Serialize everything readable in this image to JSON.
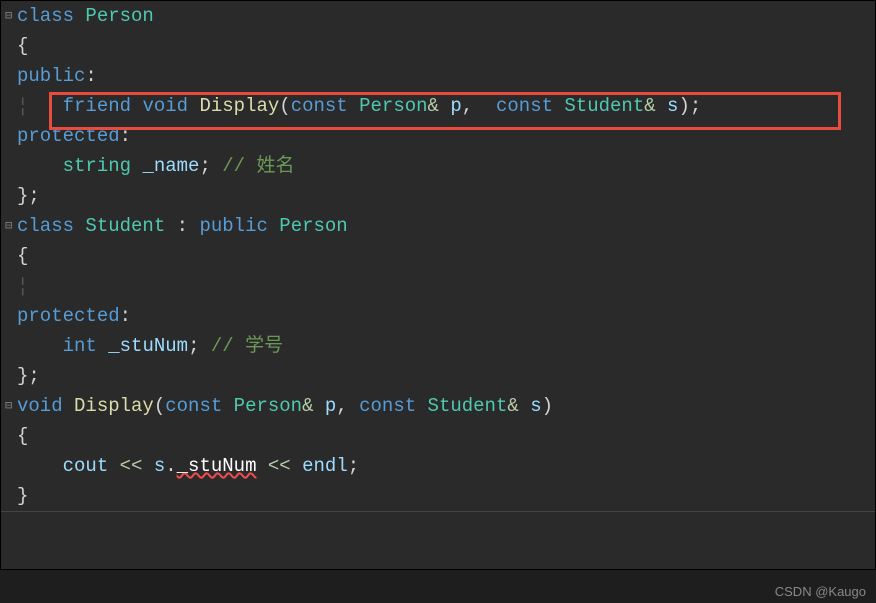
{
  "lines": {
    "l1_class": "class",
    "l1_name": "Person",
    "l2_brace": "{",
    "l3_public": "public",
    "l3_colon": ":",
    "l4_friend": "friend",
    "l4_void": "void",
    "l4_fn": "Display",
    "l4_const1": "const",
    "l4_t1": "Person",
    "l4_amp1": "&",
    "l4_p1": "p",
    "l4_comma": ",",
    "l4_const2": "const",
    "l4_t2": "Student",
    "l4_amp2": "&",
    "l4_p2": "s",
    "l4_paren_close": ");",
    "l5_protected": "protected",
    "l5_colon": ":",
    "l6_type": "string",
    "l6_name": "_name",
    "l6_semi": ";",
    "l6_comment": "// 姓名",
    "l7_close": "};",
    "l8_class": "class",
    "l8_name": "Student",
    "l8_colon": ":",
    "l8_public": "public",
    "l8_base": "Person",
    "l9_brace": "{",
    "l11_protected": "protected",
    "l11_colon": ":",
    "l12_type": "int",
    "l12_name": "_stuNum",
    "l12_semi": ";",
    "l12_comment": "// 学号",
    "l13_close": "};",
    "l14_void": "void",
    "l14_fn": "Display",
    "l14_const1": "const",
    "l14_t1": "Person",
    "l14_amp1": "&",
    "l14_p1": "p",
    "l14_comma": ",",
    "l14_const2": "const",
    "l14_t2": "Student",
    "l14_amp2": "&",
    "l14_p2": "s",
    "l14_paren_close": ")",
    "l15_brace": "{",
    "l16_cout": "cout",
    "l16_op1": "<<",
    "l16_s": "s",
    "l16_dot": ".",
    "l16_member": "_stuNum",
    "l16_op2": "<<",
    "l16_endl": "endl",
    "l16_semi": ";",
    "l17_brace": "}"
  },
  "watermark": "CSDN @Kaugo"
}
